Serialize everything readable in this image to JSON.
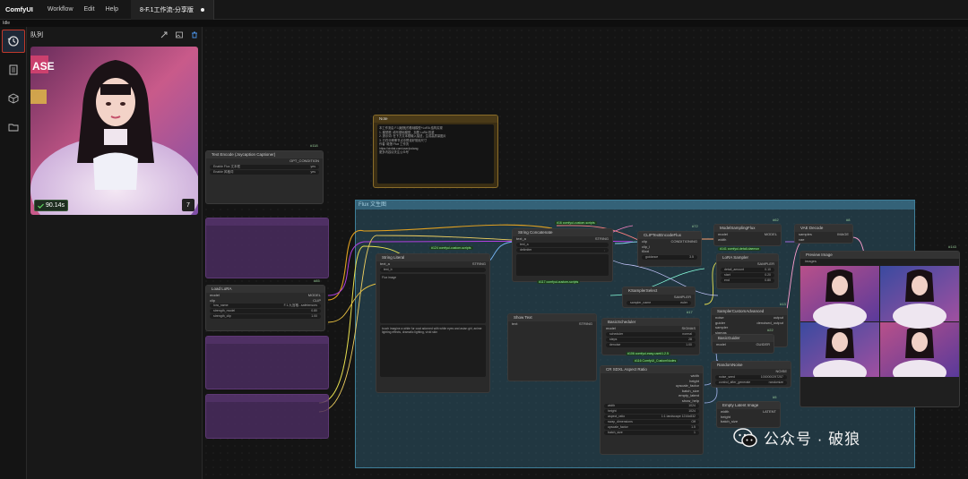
{
  "app": {
    "logo": "ComfyUI",
    "menu": [
      "Workflow",
      "Edit",
      "Help"
    ],
    "active_tab": "8-F.1工作流-分享版",
    "status": "Idle"
  },
  "sidebar": {
    "icons": [
      "history-icon",
      "document-icon",
      "cube-icon",
      "folder-icon"
    ]
  },
  "queue_panel": {
    "title": "队列",
    "duration": "90.14s",
    "count": "7"
  },
  "canvas": {
    "group_title": "Flux 文生图",
    "nodes": {
      "text_encode": {
        "title": "Text Encode (Joycaption Captioner)",
        "output": "OPT_CONDITION",
        "rows": [
          [
            "Enable Flux 文本框",
            "yes"
          ],
          [
            "Enable 风格词",
            "yes"
          ]
        ],
        "id": "#118"
      },
      "note": {
        "title": "Note",
        "lines": [
          "本工作流由 F.1[破狼]的基础模型+LoRA 结构实现",
          "1. 模型框: 填写基础模型，加载 LoRA 权重",
          "2. 提示词: 在下方文本框输入描述，生成高质量图片",
          "3. 已在分辨率节点中预设好常用尺寸",
          "",
          "作者: 破狼 Flux 工作流",
          "https://civitai.com/user/polang",
          "更多内容请关注公众号"
        ]
      },
      "load_lora": {
        "title": "Load LoRA",
        "inputs": [
          "model",
          "clip"
        ],
        "outputs": [
          "MODEL",
          "CLIP"
        ],
        "fields": [
          [
            "lora_name",
            "F.1-九宫格...safetensors"
          ],
          [
            "strength_model",
            "0.80"
          ],
          [
            "strength_clip",
            "1.00"
          ]
        ],
        "id": "#85"
      },
      "string_literal_1": {
        "title": "String Literal",
        "tags": [
          "#124 comfyui-custom-scripts"
        ],
        "output": "STRING",
        "fields": [
          [
            "text_a",
            ""
          ],
          [
            "text_b",
            ""
          ]
        ],
        "prompt_text": "Flux image",
        "bottom_text": "touch imagine a white fur coat adorned with white eyes and asian girl, anime lighting effects, dramatic lighting, vivid skin"
      },
      "string_concat": {
        "title": "String Concatenate",
        "tags": [
          "#16 comfyui-custom-scripts"
        ],
        "inputs": [
          "text_a",
          "text_b"
        ],
        "output": "STRING",
        "fields": [
          [
            "delimiter",
            ","
          ]
        ]
      },
      "show_text": {
        "title": "Show Text",
        "tags": [
          "#117 comfyui-custom-scripts"
        ],
        "input": "text",
        "output": "STRING"
      },
      "clip_text_encode": {
        "title": "CLIPTextEncodeFlux",
        "id": "#72",
        "inputs": [
          "clip",
          "clip_l",
          "t5xxl"
        ],
        "output": "CONDITIONING",
        "fields": [
          [
            "guidance",
            "3.5"
          ]
        ]
      },
      "ksampler_select": {
        "title": "KSamplerSelect",
        "output": "SAMPLER",
        "fields": [
          [
            "sampler_name",
            "euler"
          ]
        ],
        "id": "#17"
      },
      "basic_scheduler": {
        "title": "BasicScheduler",
        "inputs": [
          "model"
        ],
        "output": "SIGMAS",
        "fields": [
          [
            "scheduler",
            "normal"
          ],
          [
            "steps",
            "28"
          ],
          [
            "denoise",
            "1.00"
          ]
        ],
        "id": "#17"
      },
      "aspect_ratio": {
        "title": "CR SDXL Aspect Ratio",
        "tags": [
          "#106 comfyui-easy-use#1.2.5",
          "#116 ComfyUI_CustomNodes"
        ],
        "outputs": [
          "width",
          "height",
          "upscale_factor",
          "batch_size",
          "empty_latent",
          "show_help"
        ],
        "fields": [
          [
            "width",
            "1024"
          ],
          [
            "height",
            "1024"
          ],
          [
            "aspect_ratio",
            "1:1 landscape 1216x832"
          ],
          [
            "swap_dimensions",
            "Off"
          ],
          [
            "upscale_factor",
            "1.5"
          ],
          [
            "batch_size",
            "1"
          ]
        ]
      },
      "model_sampler": {
        "title": "ModelSamplingFlux",
        "output": "MODEL",
        "inputs": [
          "model",
          "width",
          "height"
        ],
        "id": "#62"
      },
      "lora_sampler": {
        "title": "LoRA Sampler",
        "tags": [
          "#141 comfyui-detail-daemon"
        ],
        "output": "SAMPLER",
        "fields": [
          [
            "detail_amount",
            "0.10"
          ],
          [
            "start",
            "0.20"
          ],
          [
            "end",
            "0.80"
          ]
        ]
      },
      "sampler_custom": {
        "title": "SamplerCustomAdvanced",
        "inputs": [
          "noise",
          "guider",
          "sampler",
          "sigmas",
          "latent_image"
        ],
        "outputs": [
          "output",
          "denoised_output"
        ],
        "id": "#13"
      },
      "random_noise": {
        "title": "RandomNoise",
        "output": "NOISE",
        "fields": [
          [
            "noise_seed",
            "1000000297257"
          ],
          [
            "control_after_generate",
            "randomize"
          ]
        ],
        "id": "#25"
      },
      "empty_latent": {
        "title": "Empty Latent Image",
        "inputs": [
          "width",
          "height",
          "batch_size"
        ],
        "output": "LATENT",
        "id": "#5"
      },
      "vae_decode": {
        "title": "VAE Decode",
        "inputs": [
          "samples",
          "vae"
        ],
        "output": "IMAGE",
        "id": "#8"
      },
      "preview_image": {
        "title": "Preview Image",
        "input": "images",
        "id": "#143"
      },
      "ksampler_guider": {
        "title": "BasicGuider",
        "inputs": [
          "model",
          "conditioning"
        ],
        "output": "GUIDER",
        "id": "#22"
      }
    }
  },
  "watermark": {
    "text": "公众号 · 破狼"
  },
  "colors": {
    "accent": "#c0392b",
    "group": "#3e7f99",
    "purple_node": "#4a2c5e",
    "note_border": "#8a6d2a"
  }
}
